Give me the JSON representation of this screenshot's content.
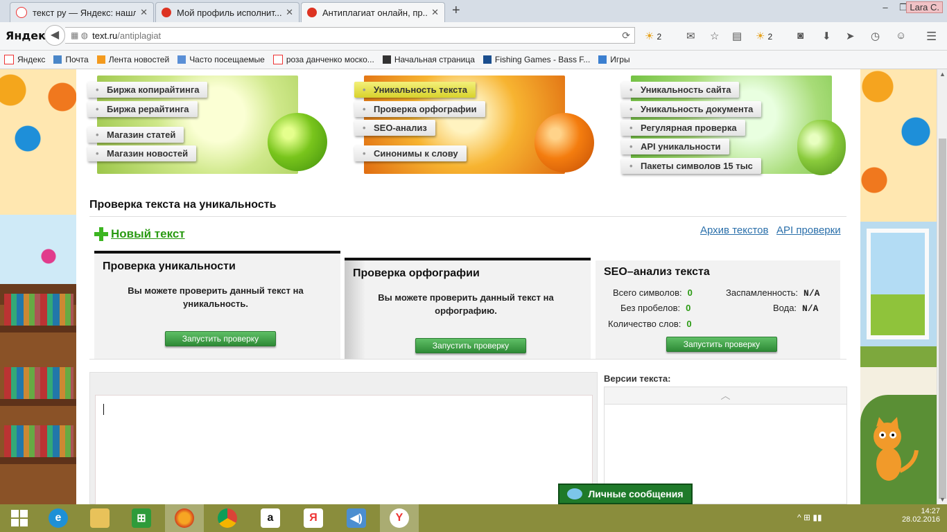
{
  "browser": {
    "tabs": [
      {
        "label": "текст ру — Яндекс: нашл...",
        "favicon_color": "#e33",
        "active": false
      },
      {
        "label": "Мой профиль исполнит...",
        "favicon_color": "#d32",
        "active": false
      },
      {
        "label": "Антиплагиат онлайн, пр...",
        "favicon_color": "#d32",
        "active": true
      }
    ],
    "new_tab": "+",
    "user": "Lara C.",
    "logo": "Яндекс",
    "url_host": "text.ru",
    "url_path": "/antiplagiat",
    "weather_1": "2",
    "weather_2": "2",
    "bookmarks": [
      "Яндекс",
      "Почта",
      "Лента новостей",
      "Часто посещаемые",
      "роза данченко моско...",
      "Начальная страница",
      "Fishing Games - Bass F...",
      "Игры"
    ]
  },
  "banners": {
    "left": [
      "Биржа копирайтинга",
      "Биржа рерайтинга",
      "Магазин статей",
      "Магазин новостей"
    ],
    "middle": [
      "Уникальность текста",
      "Проверка орфографии",
      "SEO-анализ",
      "Синонимы к слову"
    ],
    "right": [
      "Уникальность сайта",
      "Уникальность документа",
      "Регулярная проверка",
      "API уникальности",
      "Пакеты символов 15 тыс"
    ]
  },
  "page": {
    "title": "Проверка текста на уникальность",
    "new_text": "Новый текст",
    "archive_link": "Архив текстов",
    "api_link": "API проверки"
  },
  "panels": {
    "uniqueness": {
      "title": "Проверка уникальности",
      "text": "Вы можете проверить данный текст на уникальность.",
      "button": "Запустить проверку"
    },
    "spelling": {
      "title": "Проверка орфографии",
      "text": "Вы можете проверить данный текст на орфографию.",
      "button": "Запустить проверку"
    },
    "seo": {
      "title": "SEO–анализ текста",
      "total_chars_label": "Всего символов:",
      "total_chars": "0",
      "no_spaces_label": "Без пробелов:",
      "no_spaces": "0",
      "word_count_label": "Количество слов:",
      "word_count": "0",
      "spam_label": "Заспамленность:",
      "spam": "N/A",
      "water_label": "Вода:",
      "water": "N/A",
      "button": "Запустить проверку"
    }
  },
  "versions_label": "Версии текста:",
  "messages_button": "Личные сообщения",
  "taskbar": {
    "time": "14:27",
    "date": "28.02.2016"
  }
}
